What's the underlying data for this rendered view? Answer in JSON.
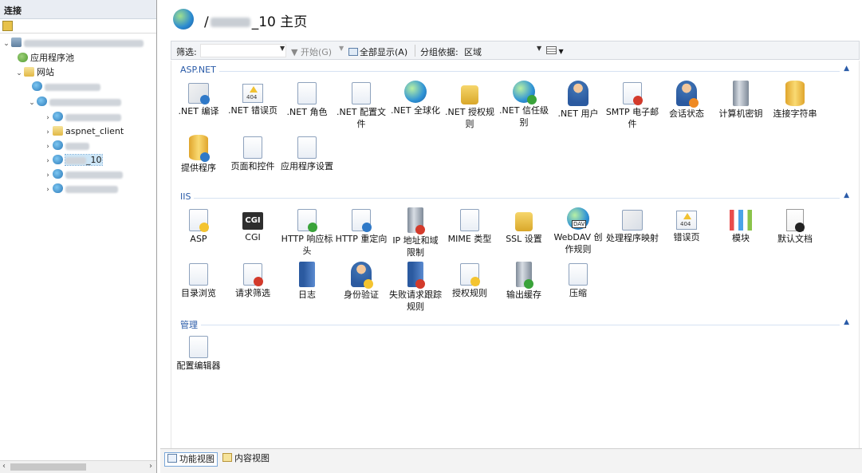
{
  "connections": {
    "title": "连接",
    "tree": {
      "app_pools": "应用程序池",
      "sites": "网站",
      "aspnet_client": "aspnet_client",
      "selected_site_suffix": "_10"
    }
  },
  "header": {
    "title_prefix": "/",
    "title_suffix": "_10 主页"
  },
  "filterbar": {
    "filter_label": "筛选:",
    "filter_value": "",
    "start_label": "开始(G)",
    "show_all_label": "全部显示(A)",
    "group_by_label": "分组依据:",
    "group_by_value": "区域"
  },
  "groups": {
    "aspnet": {
      "title": "ASP.NET",
      "items": [
        ".NET 编译",
        ".NET 错误页",
        ".NET 角色",
        ".NET 配置文件",
        ".NET 全球化",
        ".NET 授权规则",
        ".NET 信任级别",
        ".NET 用户",
        "SMTP 电子邮件",
        "会话状态",
        "计算机密钥",
        "连接字符串",
        "提供程序",
        "页面和控件",
        "应用程序设置"
      ]
    },
    "iis": {
      "title": "IIS",
      "items": [
        "ASP",
        "CGI",
        "HTTP 响应标头",
        "HTTP 重定向",
        "IP 地址和域限制",
        "MIME 类型",
        "SSL 设置",
        "WebDAV 创作规则",
        "处理程序映射",
        "错误页",
        "模块",
        "默认文档",
        "目录浏览",
        "请求筛选",
        "日志",
        "身份验证",
        "失败请求跟踪规则",
        "授权规则",
        "输出缓存",
        "压缩"
      ]
    },
    "management": {
      "title": "管理",
      "items": [
        "配置编辑器"
      ]
    }
  },
  "icons": {
    "cgi_text": "CGI",
    "error_page_text": "404",
    "webdav_text": "DAV"
  },
  "bottom_tabs": {
    "features_view": "功能视图",
    "content_view": "内容视图"
  },
  "colors": {
    "group_title": "#2a5ba8",
    "selection": "#cde6f7",
    "header_bg": "#e9edf3"
  }
}
